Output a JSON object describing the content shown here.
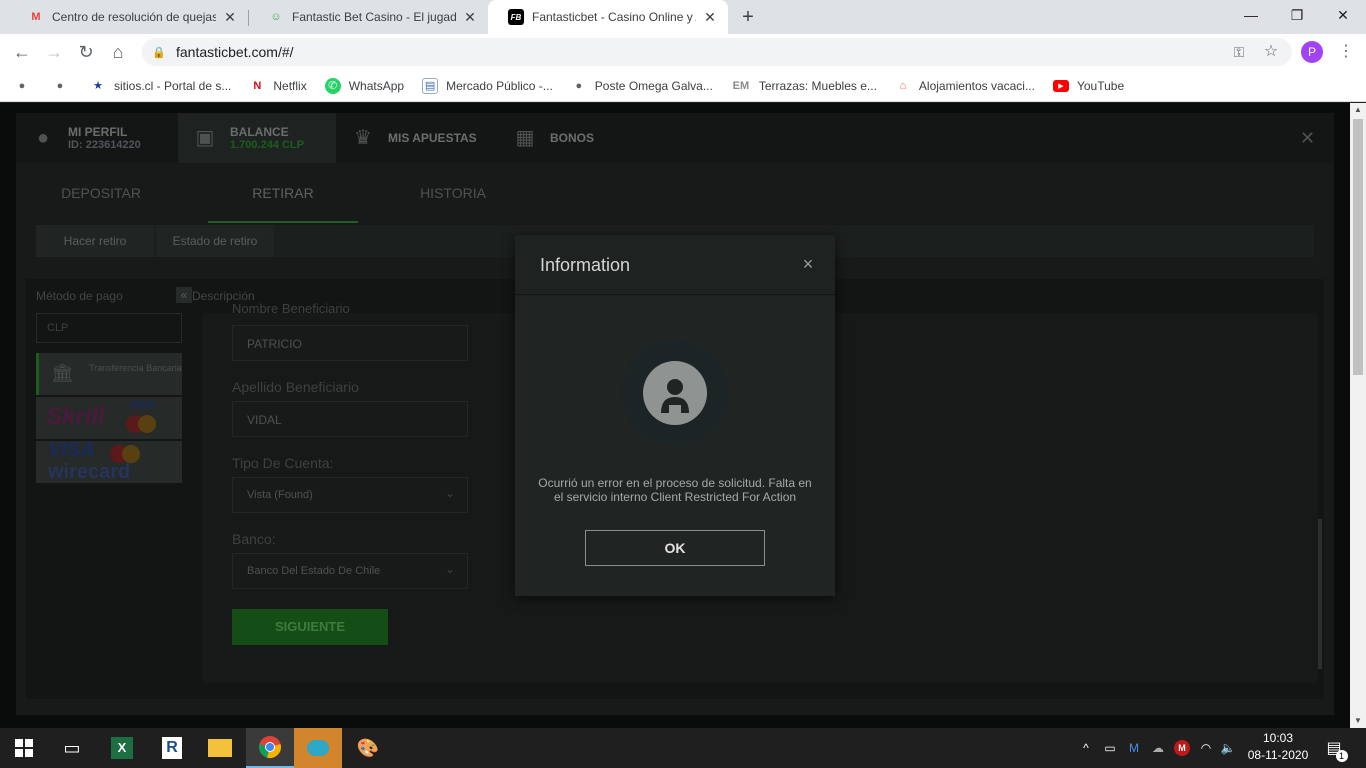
{
  "browser": {
    "tabs": [
      {
        "title": "Centro de resolución de quejas: F",
        "favicon": "gmail-icon",
        "favicon_text": "M",
        "favicon_color": "#ea4335"
      },
      {
        "title": "Fantastic Bet Casino - El jugador",
        "favicon": "casino-icon",
        "favicon_text": "☺",
        "favicon_color": "#34a853"
      },
      {
        "title": "Fantasticbet - Casino Online y Ap",
        "favicon": "fb-logo-icon",
        "favicon_text": "FB",
        "favicon_color": "#000000"
      }
    ],
    "new_tab": "+",
    "window_controls": {
      "minimize": "—",
      "maximize": "❐",
      "close": "✕"
    },
    "url": "fantasticbet.com/#/",
    "profile_initial": "P",
    "bookmarks": [
      {
        "label": "",
        "icon": "globe-icon",
        "glyph": "🌐"
      },
      {
        "label": "",
        "icon": "globe-icon",
        "glyph": "🌐"
      },
      {
        "label": "sitios.cl - Portal de s...",
        "icon": "star-icon",
        "glyph": "★"
      },
      {
        "label": "Netflix",
        "icon": "netflix-icon",
        "glyph": "N"
      },
      {
        "label": "WhatsApp",
        "icon": "whatsapp-icon",
        "glyph": "✆"
      },
      {
        "label": "Mercado Público -...",
        "icon": "document-icon",
        "glyph": "▤"
      },
      {
        "label": "Poste Omega Galva...",
        "icon": "globe-icon",
        "glyph": "🌐"
      },
      {
        "label": "Terrazas: Muebles e...",
        "icon": "em-icon",
        "glyph": "EM"
      },
      {
        "label": "Alojamientos vacaci...",
        "icon": "airbnb-icon",
        "glyph": "⌂"
      },
      {
        "label": "YouTube",
        "icon": "youtube-icon",
        "glyph": "▶"
      }
    ]
  },
  "site": {
    "topnav": {
      "profile_label": "MI PERFIL",
      "profile_id": "ID: 223614220",
      "balance_label": "BALANCE",
      "balance_value": "1.700.244 CLP",
      "bets_label": "MIS APUESTAS",
      "bonus_label": "BONOS",
      "close": "✕"
    },
    "subtabs": [
      "DEPOSITAR",
      "RETIRAR",
      "HISTORIA"
    ],
    "innertabs": [
      "Hacer retiro",
      "Estado de retiro"
    ],
    "payment_method_label": "Método de pago",
    "description_label": "Descripción",
    "currency": "CLP",
    "methods": {
      "bank_transfer": "Transferencia Bancaria",
      "skrill": "Skrill",
      "visa": "VISA",
      "wirecard": "wirecard"
    },
    "form": {
      "first_name_label": "Nombre Beneficiario",
      "first_name_value": "PATRICIO",
      "last_name_label": "Apellido Beneficiario",
      "last_name_value": "VIDAL",
      "account_type_label": "Tipo De Cuenta:",
      "account_type_value": "Vista (Found)",
      "bank_label": "Banco:",
      "bank_value": "Banco Del Estado De Chile",
      "submit": "SIGUIENTE"
    }
  },
  "modal": {
    "title": "Information",
    "close": "×",
    "message": "Ocurrió un error en el proceso de solicitud. Falta en el servicio interno Client Restricted For Action",
    "ok": "OK"
  },
  "taskbar": {
    "time": "10:03",
    "date": "08-11-2020",
    "notification_count": "1"
  },
  "colors": {
    "accent_green": "#1b5e1b",
    "modal_bg": "#1e2221",
    "chrome_tab_bg": "#dee1e6"
  }
}
